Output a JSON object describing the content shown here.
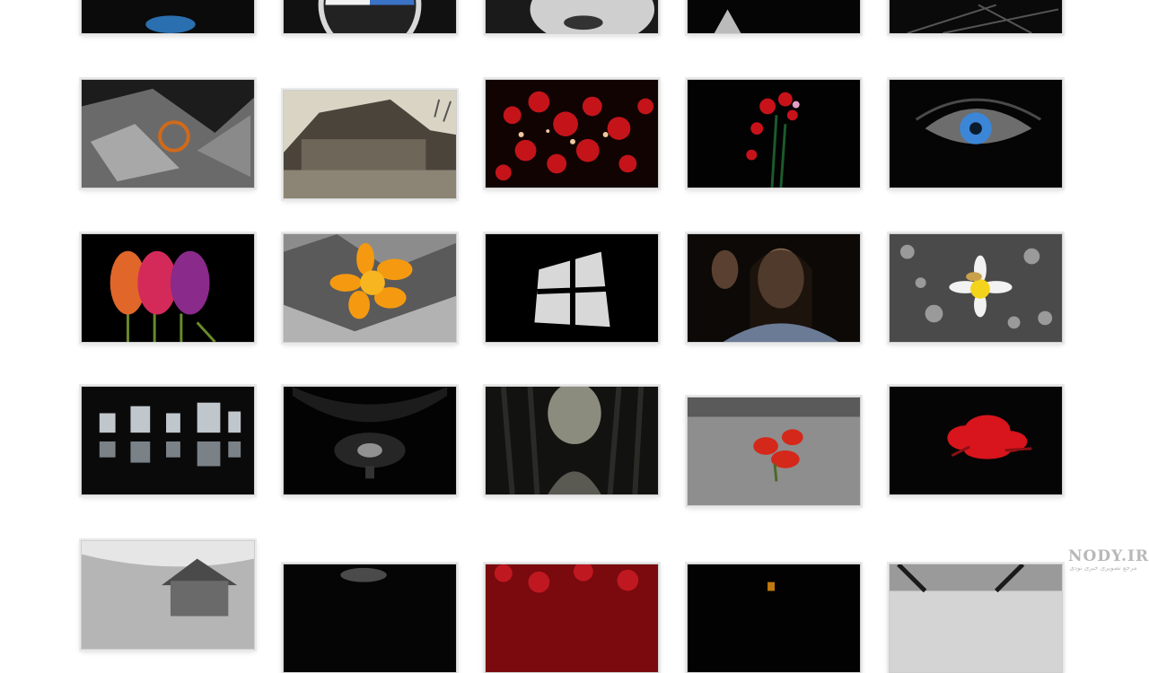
{
  "gallery": {
    "thumbnails": [
      {
        "subject": "dark-abstract",
        "row": 0,
        "col": 0
      },
      {
        "subject": "car-emblem",
        "row": 0,
        "col": 1
      },
      {
        "subject": "face-portrait",
        "row": 0,
        "col": 2
      },
      {
        "subject": "dark-figure",
        "row": 0,
        "col": 3
      },
      {
        "subject": "dark-lines",
        "row": 0,
        "col": 4
      },
      {
        "subject": "bw-abstract-orange-ring",
        "row": 1,
        "col": 0
      },
      {
        "subject": "old-house",
        "row": 1,
        "col": 1
      },
      {
        "subject": "red-bokeh",
        "row": 1,
        "col": 2
      },
      {
        "subject": "red-flowers-bouquet",
        "row": 1,
        "col": 3
      },
      {
        "subject": "blue-eye",
        "row": 1,
        "col": 4
      },
      {
        "subject": "tulips",
        "row": 2,
        "col": 0
      },
      {
        "subject": "orange-flower",
        "row": 2,
        "col": 1
      },
      {
        "subject": "window-light",
        "row": 2,
        "col": 2
      },
      {
        "subject": "girl-portrait",
        "row": 2,
        "col": 3
      },
      {
        "subject": "daisy",
        "row": 2,
        "col": 4
      },
      {
        "subject": "city-reflection",
        "row": 3,
        "col": 0
      },
      {
        "subject": "night-light",
        "row": 3,
        "col": 1
      },
      {
        "subject": "forest-path",
        "row": 3,
        "col": 2
      },
      {
        "subject": "red-flower-field",
        "row": 3,
        "col": 3
      },
      {
        "subject": "red-rose",
        "row": 3,
        "col": 4
      },
      {
        "subject": "house-sky",
        "row": 4,
        "col": 0
      },
      {
        "subject": "dark-shape",
        "row": 4,
        "col": 1
      },
      {
        "subject": "red-foliage",
        "row": 4,
        "col": 2
      },
      {
        "subject": "dark-light",
        "row": 4,
        "col": 3
      },
      {
        "subject": "bw-beams",
        "row": 4,
        "col": 4
      }
    ]
  },
  "watermark": {
    "logo": "NODY.IR",
    "subline": "مرجع تصویری خبری نودی"
  }
}
